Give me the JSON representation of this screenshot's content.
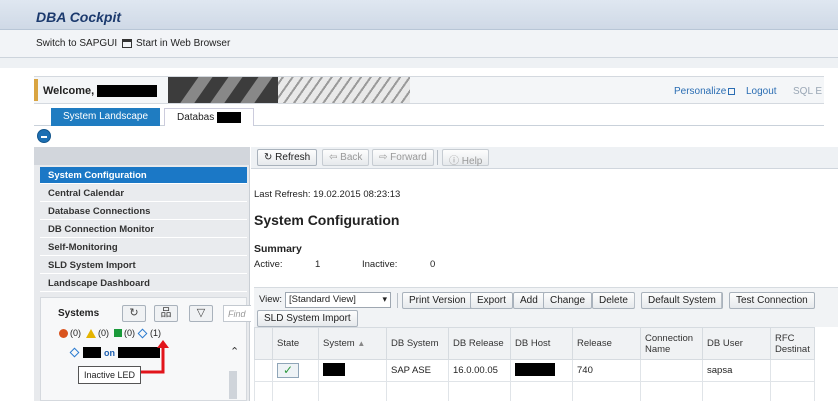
{
  "app": {
    "title": "DBA Cockpit"
  },
  "toolbar": {
    "switch_label": "Switch to SAPGUI",
    "browser_label": "Start in Web Browser"
  },
  "welcome": {
    "text": "Welcome,",
    "links": [
      "Personalize",
      "Logout",
      "SQL E"
    ]
  },
  "tabs": [
    {
      "label": "System Landscape",
      "active": true
    },
    {
      "label": "Databas",
      "active": false
    }
  ],
  "nav": {
    "items": [
      "System Configuration",
      "Central Calendar",
      "Database Connections",
      "DB Connection Monitor",
      "Self-Monitoring",
      "SLD System Import",
      "Landscape Dashboard"
    ],
    "selected": "System Configuration"
  },
  "systems": {
    "label": "Systems",
    "find_placeholder": "Find",
    "legend": [
      {
        "icon": "red-led-icon",
        "count": "(0)",
        "color": "#d9531e"
      },
      {
        "icon": "warning-icon",
        "count": "(0)",
        "color": "#e5b400"
      },
      {
        "icon": "green-led-icon",
        "count": "(0)",
        "color": "#1a9a3a"
      },
      {
        "icon": "inactive-led-icon",
        "count": "(1)",
        "color": "#2b7bd0"
      }
    ],
    "tree_item_on": "on",
    "tooltip": "Inactive LED"
  },
  "main": {
    "buttons": {
      "refresh": "Refresh",
      "back": "Back",
      "forward": "Forward",
      "help": "Help"
    },
    "last_refresh_label": "Last Refresh:",
    "last_refresh_value": "19.02.2015 08:23:13",
    "title": "System Configuration",
    "summary": {
      "heading": "Summary",
      "active_label": "Active:",
      "active_value": "1",
      "inactive_label": "Inactive:",
      "inactive_value": "0"
    },
    "table_toolbar": {
      "view_label": "View:",
      "view_value": "[Standard View]",
      "buttons": [
        "Print Version",
        "Export",
        "Add",
        "Change",
        "Delete",
        "Default System",
        "Test Connection"
      ],
      "sld_button": "SLD System Import"
    },
    "table": {
      "headers": [
        "State",
        "System",
        "DB System",
        "DB Release",
        "DB Host",
        "Release",
        "Connection Name",
        "DB User",
        "RFC Destinat"
      ],
      "rows": [
        {
          "state": "check",
          "system": "",
          "db_system": "SAP ASE",
          "db_release": "16.0.00.05",
          "db_host": "",
          "release": "740",
          "connection_name": "",
          "db_user": "sapsa",
          "rfc": ""
        }
      ]
    }
  }
}
